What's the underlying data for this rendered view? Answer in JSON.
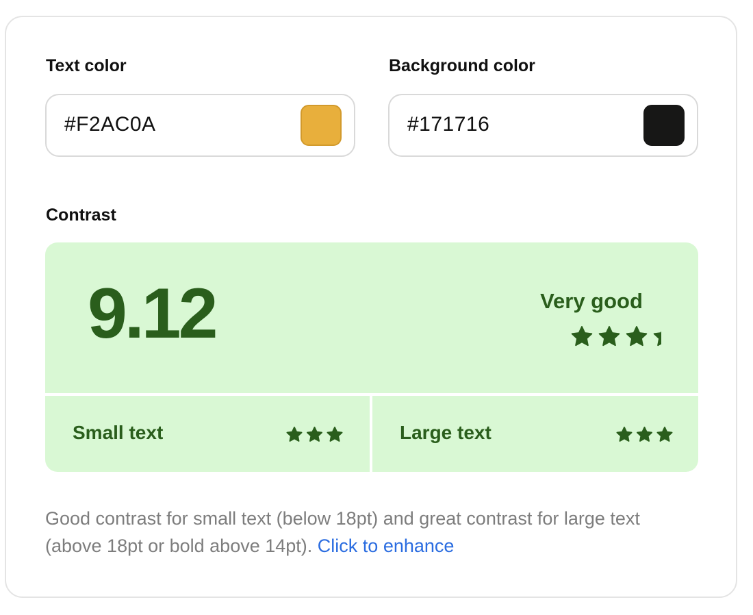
{
  "text_color": {
    "label": "Text color",
    "value": "#F2AC0A",
    "swatch_color": "#E8AF3C"
  },
  "background_color": {
    "label": "Background color",
    "value": "#171716",
    "swatch_color": "#171716"
  },
  "contrast": {
    "label": "Contrast",
    "ratio": "9.12",
    "rating_label": "Very good",
    "rating_stars": 4,
    "rating_max": 5
  },
  "small_text": {
    "label": "Small text",
    "stars": 3
  },
  "large_text": {
    "label": "Large text",
    "stars": 3
  },
  "description": {
    "text": "Good contrast for small text (below 18pt) and great contrast for large text (above 18pt or bold above 14pt).",
    "link_text": "Click to enhance"
  },
  "colors": {
    "panel_bg": "#D9F8D4",
    "accent_green": "#2A5E1C",
    "star_empty": "#A6CE9C",
    "link": "#2A6CE0"
  },
  "icons": {
    "star": "star-icon",
    "star_empty": "star-empty-icon"
  }
}
